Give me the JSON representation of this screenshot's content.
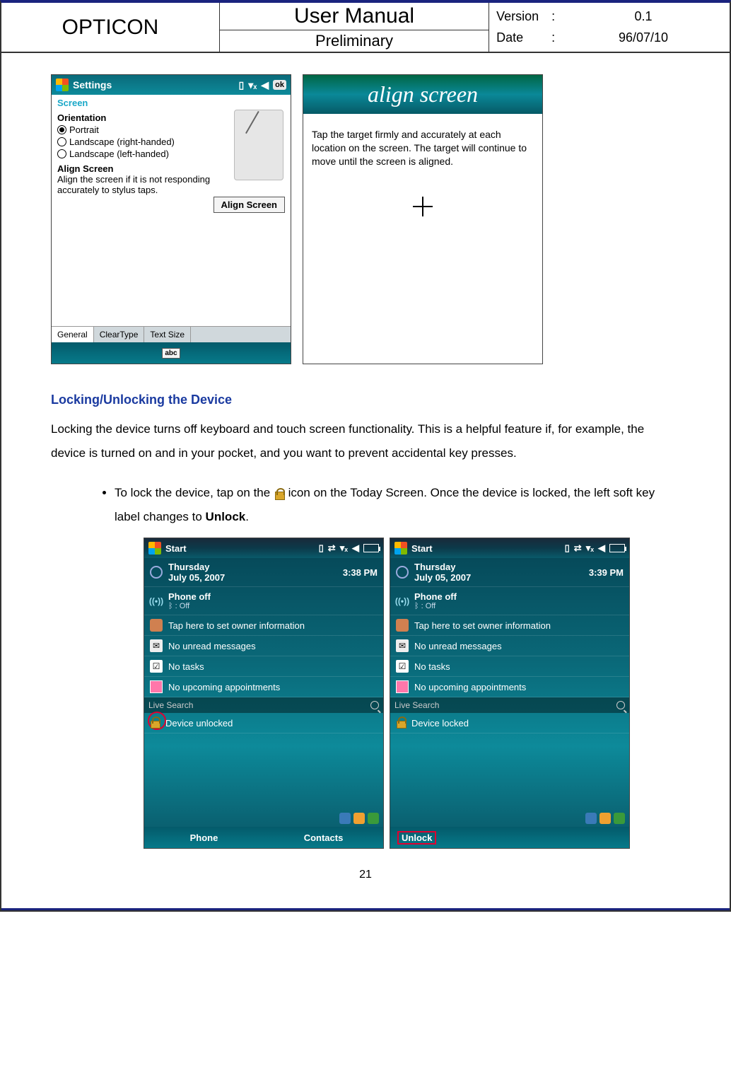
{
  "header": {
    "company": "OPTICON",
    "title": "User Manual",
    "subtitle": "Preliminary",
    "version_label": "Version",
    "version_value": "0.1",
    "date_label": "Date",
    "date_value": "96/07/10"
  },
  "screenshot1": {
    "title": "Settings",
    "ok": "ok",
    "screen_label": "Screen",
    "orientation_label": "Orientation",
    "orient_options": {
      "portrait": "Portrait",
      "land_r": "Landscape (right-handed)",
      "land_l": "Landscape (left-handed)"
    },
    "align_label": "Align Screen",
    "align_desc": "Align the screen if it is not responding accurately to stylus taps.",
    "align_button": "Align Screen",
    "tabs": {
      "general": "General",
      "cleartype": "ClearType",
      "textsize": "Text Size"
    },
    "abc": "abc"
  },
  "screenshot2": {
    "banner": "align screen",
    "body": "Tap the target firmly and accurately at each location on the screen. The target will continue to move until the screen is aligned."
  },
  "section": {
    "heading": "Locking/Unlocking the Device",
    "paragraph": "Locking the device turns off keyboard and touch screen functionality. This is a helpful feature if, for example, the device is turned on and in your pocket, and you want to prevent accidental key presses.",
    "bullet_pre": "To lock the device, tap on the ",
    "bullet_post": " icon on the Today Screen. Once the device is locked, the left soft key label changes to ",
    "unlock_word": "Unlock",
    "period": "."
  },
  "today_common": {
    "start": "Start",
    "day": "Thursday",
    "date": "July 05, 2007",
    "phone_off": "Phone off",
    "bt_off": ": Off",
    "owner": "Tap here to set owner information",
    "unread": "No unread messages",
    "tasks": "No tasks",
    "appts": "No upcoming appointments",
    "live_search": "Live Search"
  },
  "today_a": {
    "time": "3:38 PM",
    "lock_status": "Device unlocked",
    "phone_btn": "Phone",
    "contacts_btn": "Contacts"
  },
  "today_b": {
    "time": "3:39 PM",
    "lock_status": "Device locked",
    "unlock_btn": "Unlock"
  },
  "page_number": "21"
}
